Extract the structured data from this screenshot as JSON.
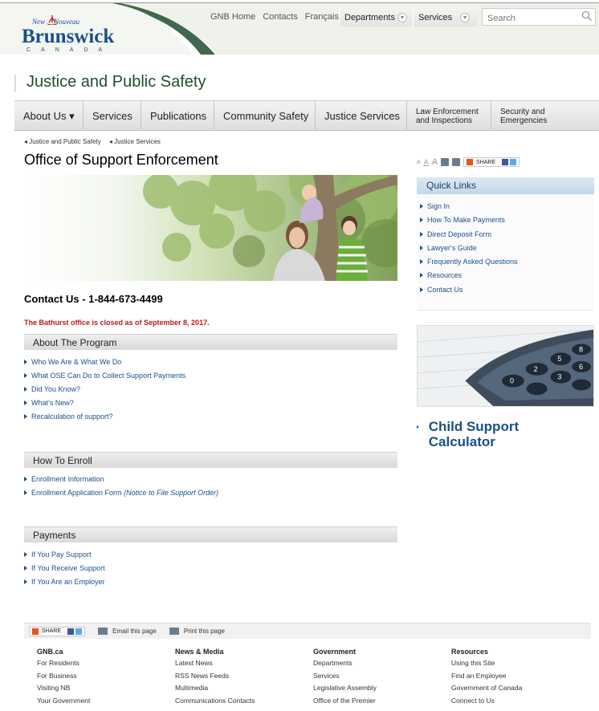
{
  "header": {
    "logo": {
      "top_left": "New",
      "top_right": "Nouveau",
      "main": "Brunswick",
      "bottom": "CANADA"
    },
    "top_links": [
      "GNB Home",
      "Contacts",
      "Français"
    ],
    "departments_label": "Departments",
    "services_label": "Services",
    "search_placeholder": "Search"
  },
  "site_title": "Justice and Public Safety",
  "main_nav": [
    {
      "label": "About Us ▾"
    },
    {
      "label": "Services"
    },
    {
      "label": "Publications"
    },
    {
      "label": "Community Safety"
    },
    {
      "label": "Justice Services"
    },
    {
      "label": "Law Enforcement and Inspections"
    },
    {
      "label": "Security and Emergencies"
    }
  ],
  "breadcrumb": [
    "◂ Justice and Public Safety",
    "◂ Justice Services"
  ],
  "page_title": "Office of Support Enforcement",
  "contact": "Contact Us - 1-844-673-4499",
  "notice": "The Bathurst office is closed as of September 8, 2017.",
  "sections": [
    {
      "title": "About The Program",
      "links": [
        "Who We Are & What We Do",
        "What OSE Can Do to Collect Support Payments",
        "Did You Know?",
        "What's New?",
        "Recalculation of support?"
      ]
    },
    {
      "title": "How To Enroll",
      "links": [
        "Enrollment Information",
        "Enrollment Application Form"
      ],
      "link_suffix": "(Notice to File Support Order)"
    },
    {
      "title": "Payments",
      "links": [
        "If You Pay Support",
        "If You Receive Support",
        "If You Are an Employer"
      ]
    }
  ],
  "right": {
    "share_label": "SHARE",
    "quick_links_title": "Quick Links",
    "quick_links": [
      "Sign In",
      "How To Make Payments",
      "Direct Deposit Form",
      "Lawyer's Guide",
      "Frequently Asked Questions",
      "Resources",
      "Contact Us"
    ],
    "calculator_link": "Child Support Calculator"
  },
  "footer": {
    "share_label": "SHARE",
    "email_page": "Email this page",
    "print_page": "Print this page",
    "columns": [
      {
        "title": "GNB.ca",
        "items": [
          "For Residents",
          "For Business",
          "Visiting NB",
          "Your Government"
        ]
      },
      {
        "title": "News & Media",
        "items": [
          "Latest News",
          "RSS News Feeds",
          "Multimedia",
          "Communications Contacts"
        ]
      },
      {
        "title": "Government",
        "items": [
          "Departments",
          "Services",
          "Legislative Assembly",
          "Office of the Premier"
        ]
      },
      {
        "title": "Resources",
        "items": [
          "Using this Site",
          "Find an Employee",
          "Government of Canada",
          "Connect to Us"
        ]
      }
    ]
  },
  "colors": {
    "link": "#1a4f8c",
    "title_green": "#1f4d2e",
    "notice_red": "#c0161a",
    "quicklinks_head": "#c4d8ea"
  }
}
